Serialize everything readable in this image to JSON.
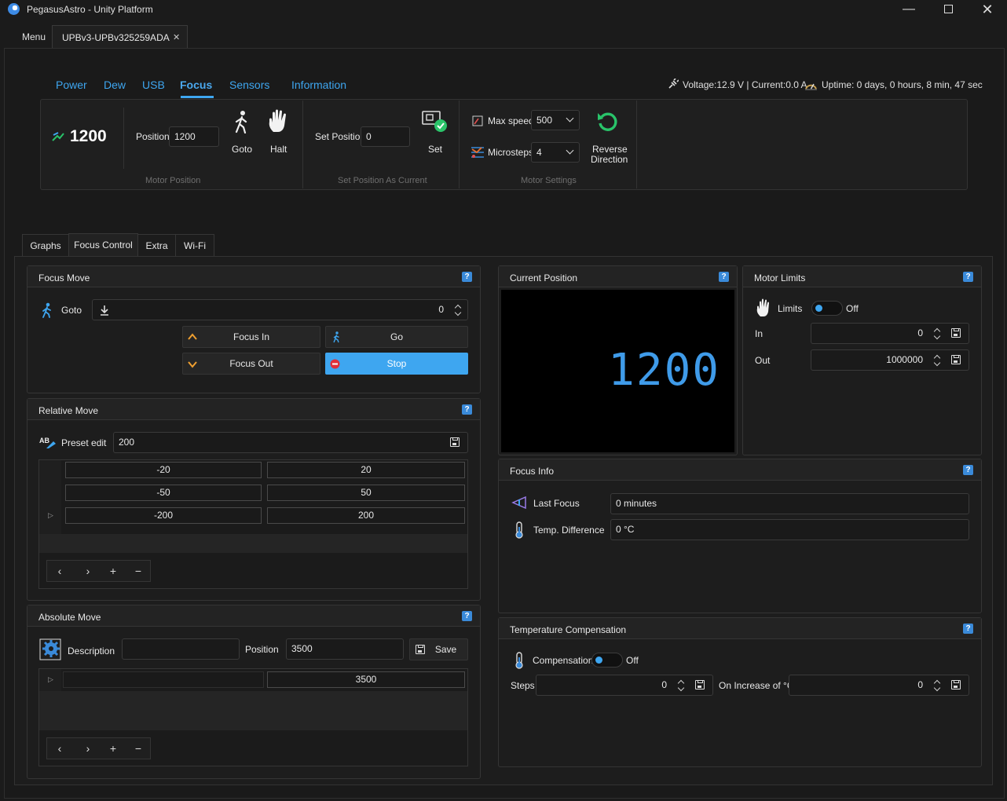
{
  "window": {
    "title": "PegasusAstro - Unity Platform"
  },
  "tabs": {
    "menu_label": "Menu",
    "device_tab": "UPBv3-UPBv325259ADA",
    "close": "✕"
  },
  "nav": [
    "Power",
    "Dew",
    "USB",
    "Focus",
    "Sensors",
    "Information"
  ],
  "nav_active": "Focus",
  "status": {
    "power": "Voltage:12.9 V | Current:0.0 A",
    "uptime": "Uptime: 0 days, 0 hours, 8 min, 47 sec"
  },
  "ribbon": {
    "position_value": "1200",
    "position_label": "Position",
    "position_input": "1200",
    "goto_label": "Goto",
    "halt_label": "Halt",
    "motor_position_group": "Motor Position",
    "set_position_label": "Set Position",
    "set_position_input": "0",
    "set_label": "Set",
    "set_position_group": "Set Position As Current",
    "max_speed_label": "Max speed",
    "max_speed_value": "500",
    "microsteps_label": "Microsteps",
    "microsteps_value": "4",
    "reverse_label_1": "Reverse",
    "reverse_label_2": "Direction",
    "motor_settings_group": "Motor Settings"
  },
  "subtabs": [
    "Graphs",
    "Focus Control",
    "Extra",
    "Wi-Fi"
  ],
  "focus_move": {
    "title": "Focus Move",
    "goto_label": "Goto",
    "goto_value": "0",
    "focus_in": "Focus In",
    "go": "Go",
    "focus_out": "Focus Out",
    "stop": "Stop"
  },
  "relative_move": {
    "title": "Relative Move",
    "preset_label": "Preset edit",
    "preset_value": "200",
    "rows": [
      [
        "-20",
        "20"
      ],
      [
        "-50",
        "50"
      ],
      [
        "-200",
        "200"
      ]
    ]
  },
  "absolute_move": {
    "title": "Absolute Move",
    "description_label": "Description",
    "description_value": "",
    "position_label": "Position",
    "position_value": "3500",
    "save_label": "Save",
    "rows": [
      [
        "",
        "3500"
      ]
    ]
  },
  "current_position": {
    "title": "Current Position",
    "value": "1200"
  },
  "motor_limits": {
    "title": "Motor Limits",
    "limits_label": "Limits",
    "limits_state": "Off",
    "in_label": "In",
    "in_value": "0",
    "out_label": "Out",
    "out_value": "1000000"
  },
  "focus_info": {
    "title": "Focus Info",
    "last_focus_label": "Last Focus",
    "last_focus_value": "0 minutes",
    "temp_diff_label": "Temp. Difference",
    "temp_diff_value": "0 °C"
  },
  "temp_comp": {
    "title": "Temperature Compensation",
    "compensation_label": "Compensation",
    "compensation_state": "Off",
    "steps_label": "Steps",
    "steps_value": "0",
    "increase_label": "On Increase of °C",
    "increase_value": "0"
  },
  "pager": {
    "prev": "‹",
    "next": "›",
    "add": "+",
    "remove": "−"
  },
  "help_glyph": "?",
  "colors": {
    "accent": "#3ea6f0",
    "help": "#3a8ad9",
    "reverse_green": "#29c46a",
    "lcd": "#3f9be9"
  }
}
